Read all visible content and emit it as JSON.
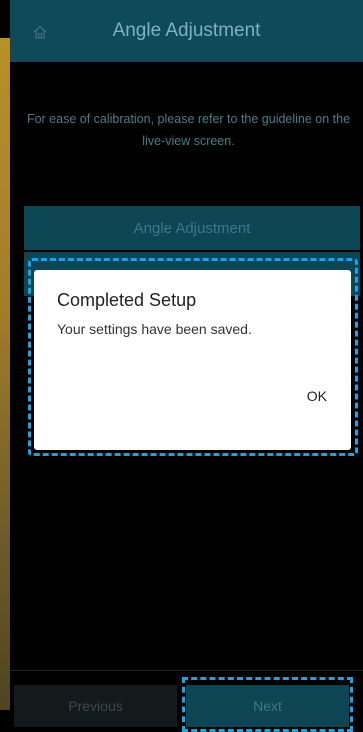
{
  "header": {
    "title": "Angle Adjustment",
    "home_icon": "home-icon"
  },
  "guide_text": "For ease of calibration, please refer to the guideline on the live-view screen.",
  "angle_button_label": "Angle Adjustment",
  "dialog": {
    "title": "Completed Setup",
    "message": "Your settings have been saved.",
    "ok_label": "OK"
  },
  "footer": {
    "previous_label": "Previous",
    "next_label": "Next"
  },
  "colors": {
    "header_bg": "#0f4a5a",
    "highlight": "#1aa3e8",
    "button_bg": "#0c4655"
  }
}
